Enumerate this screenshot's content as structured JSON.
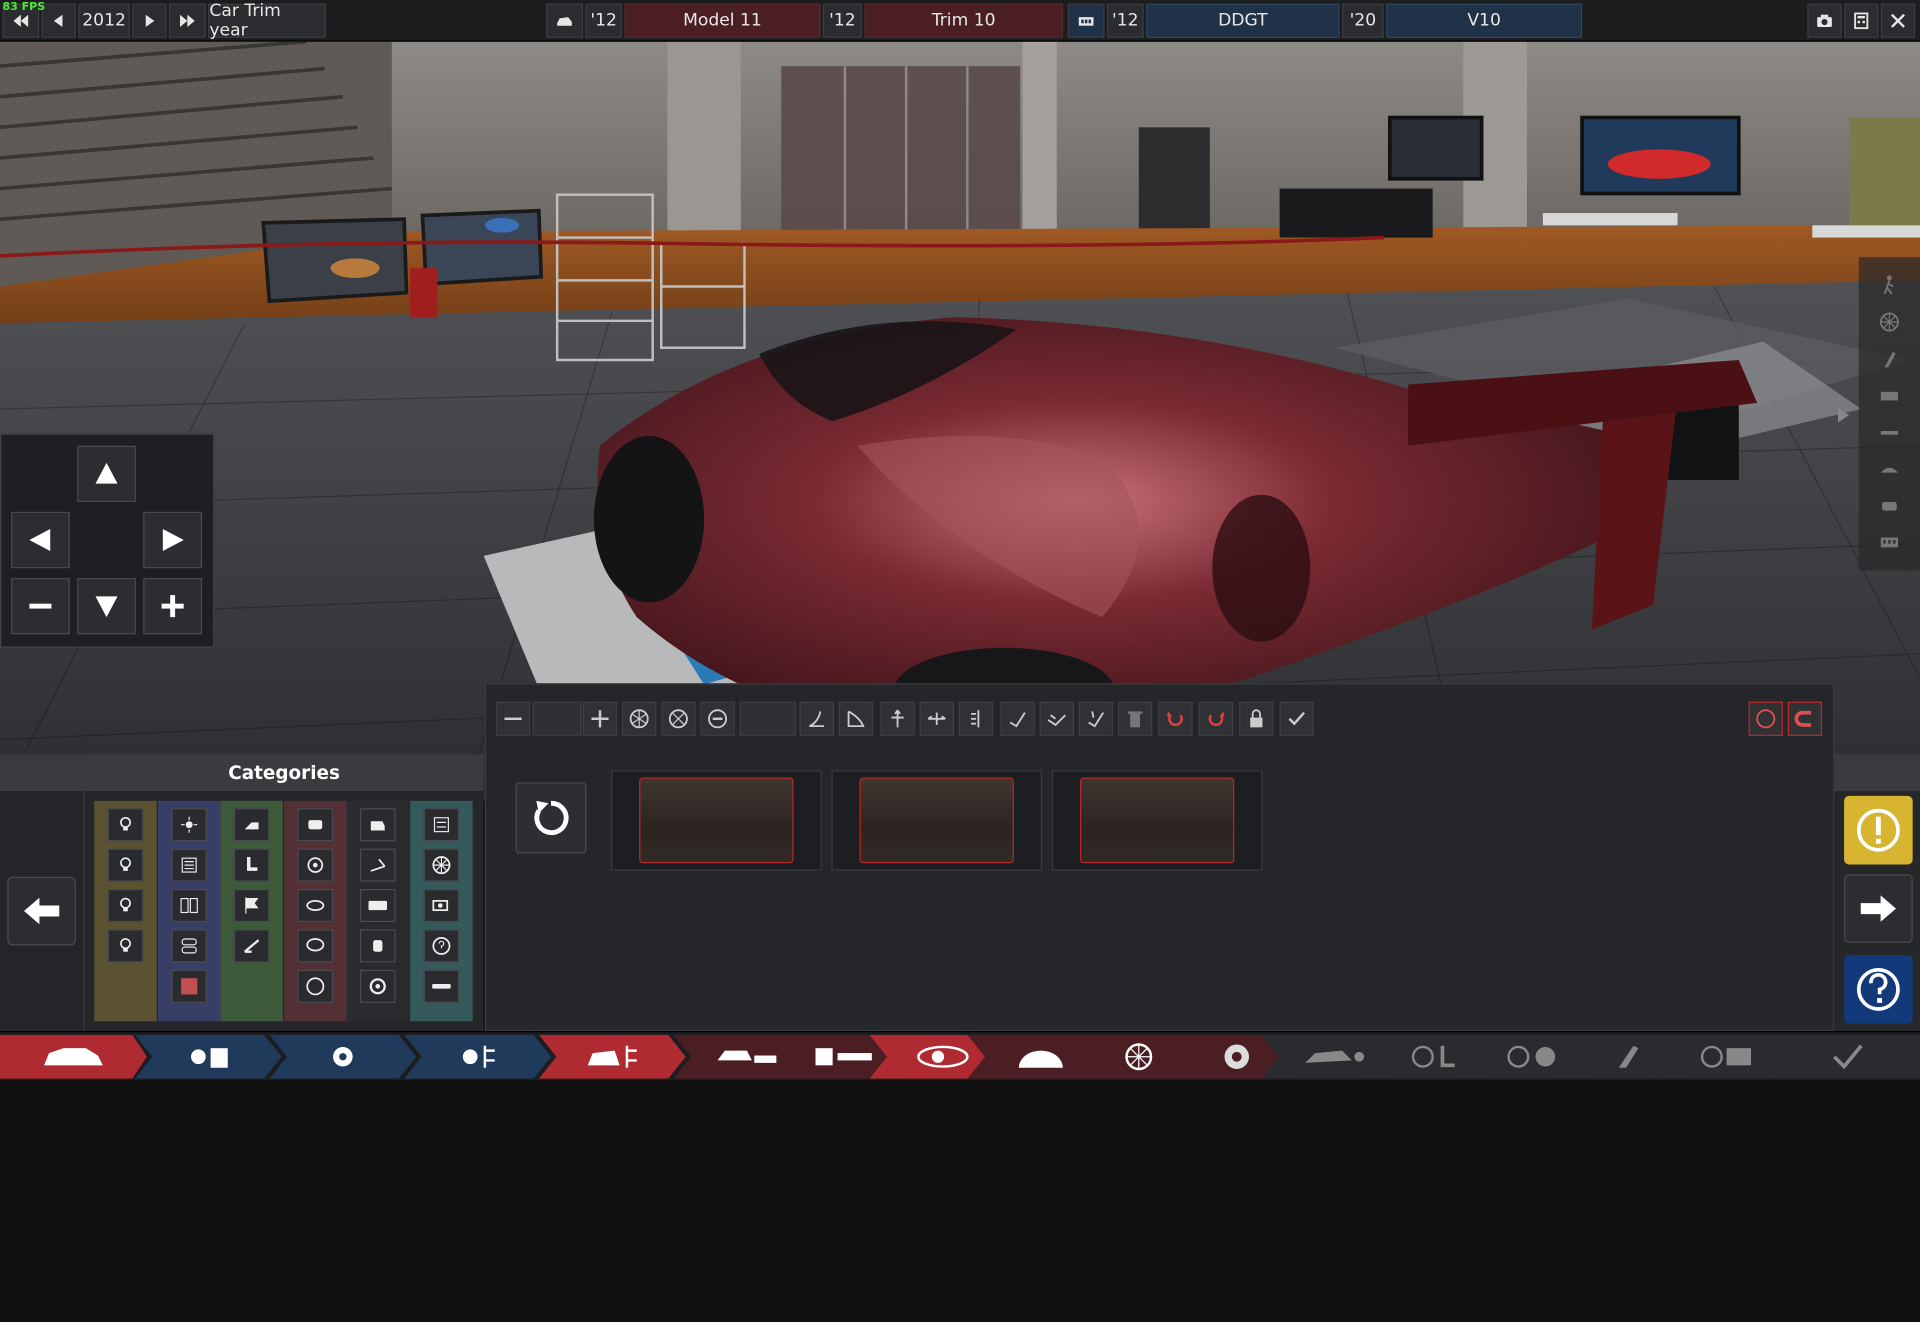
{
  "status": {
    "fps": "83 FPS"
  },
  "topbar": {
    "year": "2012",
    "year_label": "Car Trim year",
    "model_year": "'12",
    "model_name": "Model 11",
    "trim_year": "'12",
    "trim_name": "Trim 10",
    "engine_year": "'12",
    "engine_family": "DDGT",
    "variant_year": "'20",
    "variant_name": "V10"
  },
  "categories": {
    "title": "Categories",
    "columns": [
      {
        "color": "#5b5232",
        "icons": [
          "light-bulb-icon",
          "light-bulb-icon",
          "light-bulb-icon",
          "light-bulb-icon"
        ]
      },
      {
        "color": "#383f67",
        "icons": [
          "sun-badge-icon",
          "vent-grille-icon",
          "dual-vent-icon",
          "stacked-vent-icon",
          "red-panel-icon"
        ]
      },
      {
        "color": "#3d5a3a",
        "icons": [
          "side-mirror-icon",
          "seat-icon",
          "flag-icon",
          "wiper-icon"
        ]
      },
      {
        "color": "#523036",
        "icons": [
          "car-front-icon",
          "steering-wheel-icon",
          "oval-badge-icon",
          "speech-badge-icon",
          "ring-icon"
        ]
      },
      {
        "color": "#2a2b2e",
        "icons": [
          "fuel-cap-icon",
          "antenna-icon",
          "license-plate-icon",
          "door-handle-icon",
          "target-icon"
        ]
      },
      {
        "color": "#345a5c",
        "icons": [
          "grille-icon",
          "wheel-icon",
          "camera-icon",
          "question-icon",
          "bar-icon"
        ]
      }
    ]
  },
  "accent": {
    "red": "#b82a2a",
    "yellow": "#d8b531",
    "blue": "#123a7a"
  }
}
